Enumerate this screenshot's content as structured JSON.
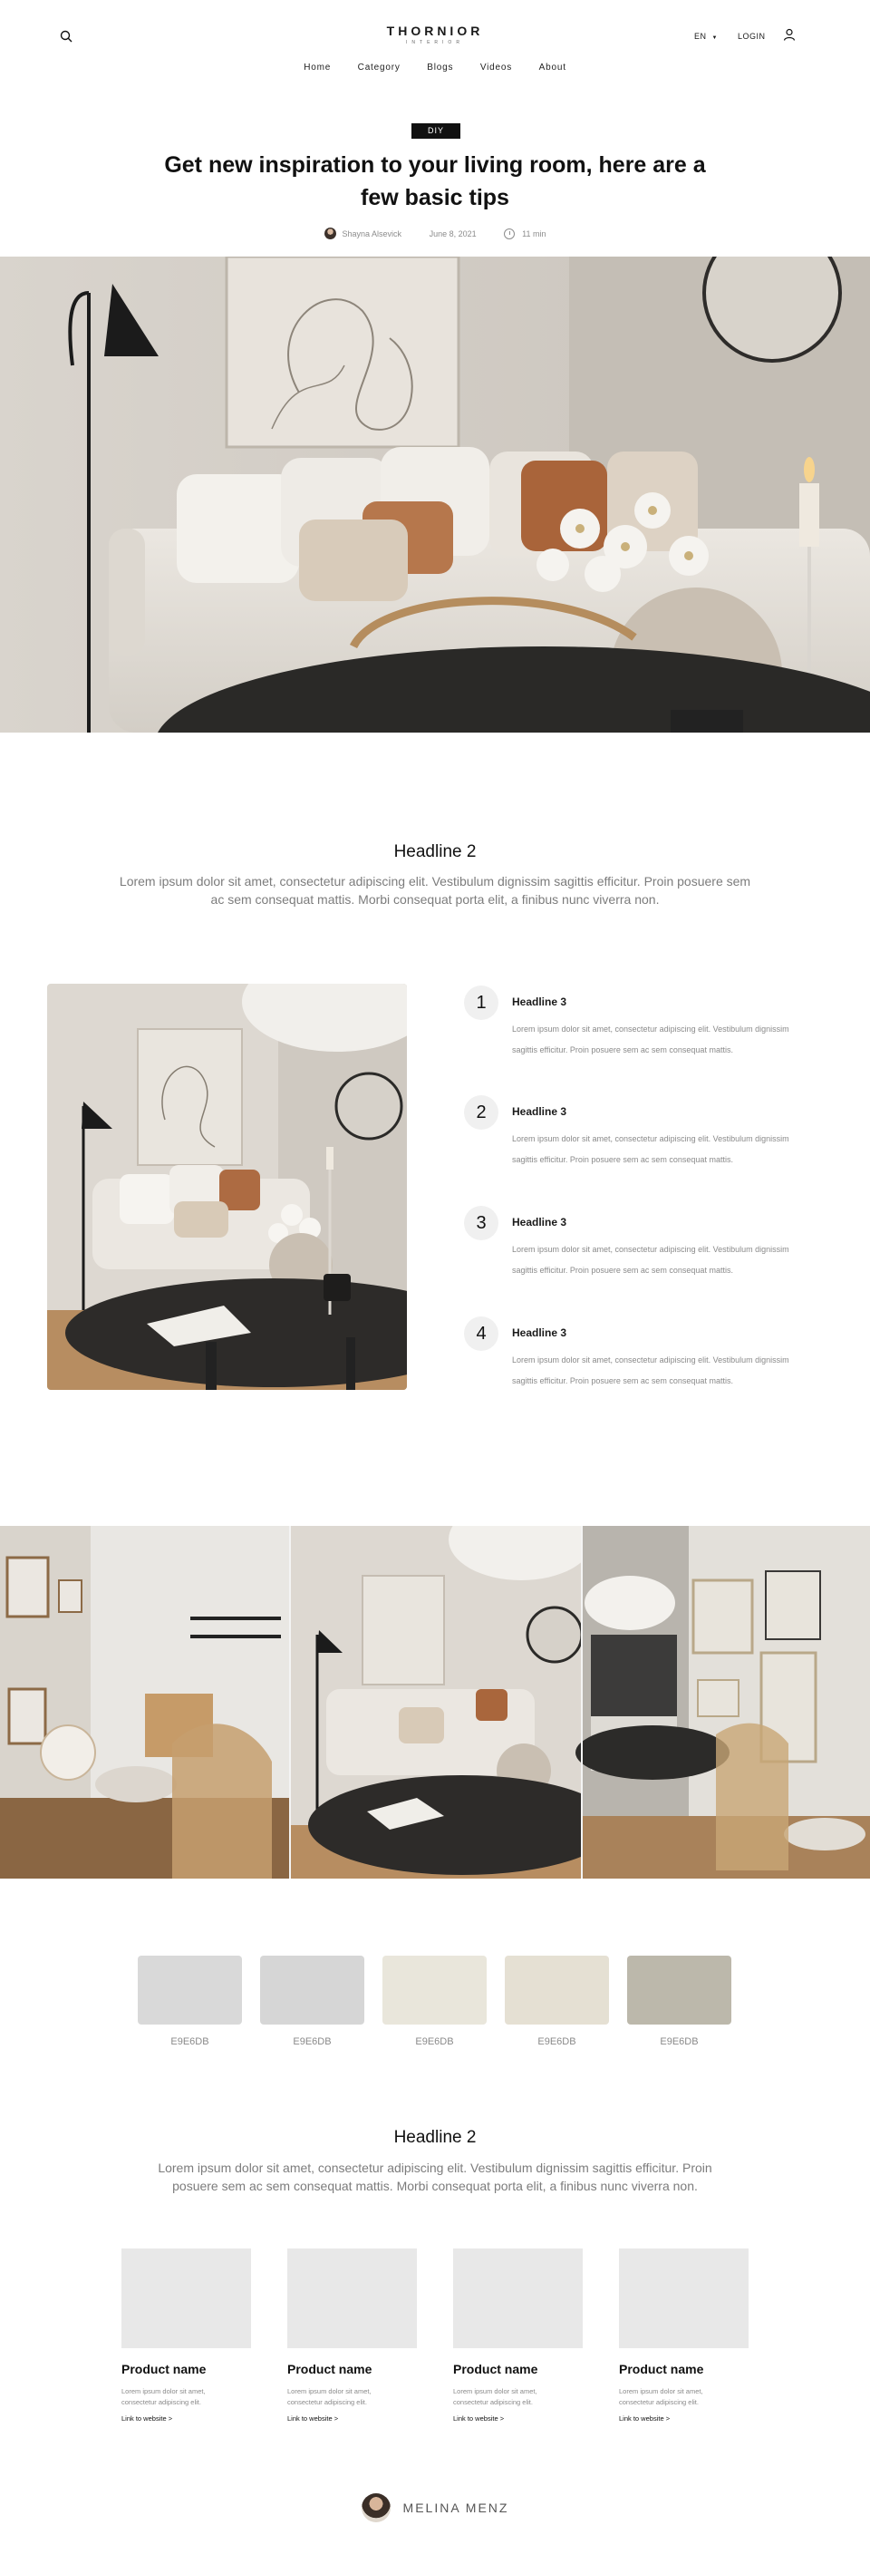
{
  "header": {
    "logo": "THORNIOR",
    "logo_sub": "INTERIOR",
    "lang": "EN",
    "login": "LOGIN",
    "nav": [
      "Home",
      "Category",
      "Blogs",
      "Videos",
      "About"
    ]
  },
  "article": {
    "badge": "DIY",
    "title": "Get new inspiration to your living room, here are a few basic tips",
    "author": "Shayna Alsevick",
    "date": "June 8, 2021",
    "read_time": "11 min"
  },
  "section1": {
    "headline": "Headline 2",
    "text": "Lorem ipsum dolor sit amet, consectetur adipiscing elit. Vestibulum dignissim sagittis efficitur. Proin posuere sem ac sem consequat mattis. Morbi consequat porta elit, a finibus nunc viverra non."
  },
  "steps": [
    {
      "num": "1",
      "headline": "Headline 3",
      "text": "Lorem ipsum dolor sit amet, consectetur adipiscing elit. Vestibulum dignissim sagittis efficitur. Proin posuere sem ac sem consequat mattis."
    },
    {
      "num": "2",
      "headline": "Headline 3",
      "text": "Lorem ipsum dolor sit amet, consectetur adipiscing elit. Vestibulum dignissim sagittis efficitur. Proin posuere sem ac sem consequat mattis."
    },
    {
      "num": "3",
      "headline": "Headline 3",
      "text": "Lorem ipsum dolor sit amet, consectetur adipiscing elit. Vestibulum dignissim sagittis efficitur. Proin posuere sem ac sem consequat mattis."
    },
    {
      "num": "4",
      "headline": "Headline 3",
      "text": "Lorem ipsum dolor sit amet, consectetur adipiscing elit. Vestibulum dignissim sagittis efficitur. Proin posuere sem ac sem consequat mattis."
    }
  ],
  "swatches": [
    {
      "label": "E9E6DB",
      "color": "#d9d9d9"
    },
    {
      "label": "E9E6DB",
      "color": "#d6d6d6"
    },
    {
      "label": "E9E6DB",
      "color": "#e9e6db"
    },
    {
      "label": "E9E6DB",
      "color": "#e5e0d3"
    },
    {
      "label": "E9E6DB",
      "color": "#bcb8ab"
    }
  ],
  "section2": {
    "headline": "Headline 2",
    "text": "Lorem ipsum dolor sit amet, consectetur adipiscing elit. Vestibulum dignissim sagittis efficitur. Proin posuere sem ac sem consequat mattis. Morbi consequat porta elit, a finibus nunc viverra non."
  },
  "products": [
    {
      "name": "Product name",
      "desc": "Lorem ipsum dolor sit amet, consectetur adipiscing elit.",
      "link": "Link to website >"
    },
    {
      "name": "Product name",
      "desc": "Lorem ipsum dolor sit amet, consectetur adipiscing elit.",
      "link": "Link to website >"
    },
    {
      "name": "Product name",
      "desc": "Lorem ipsum dolor sit amet, consectetur adipiscing elit.",
      "link": "Link to website >"
    },
    {
      "name": "Product name",
      "desc": "Lorem ipsum dolor sit amet, consectetur adipiscing elit.",
      "link": "Link to website >"
    }
  ],
  "footer": {
    "author_name": "MELINA MENZ"
  }
}
